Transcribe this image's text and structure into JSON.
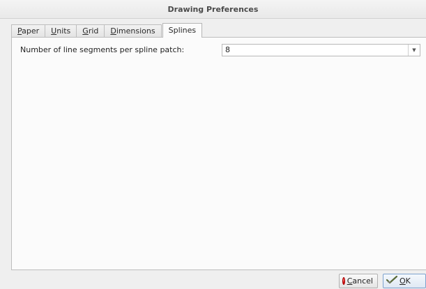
{
  "window": {
    "title": "Drawing Preferences"
  },
  "tabs": [
    {
      "mnemonic": "P",
      "rest": "aper"
    },
    {
      "mnemonic": "U",
      "rest": "nits"
    },
    {
      "mnemonic": "G",
      "rest": "rid"
    },
    {
      "mnemonic": "D",
      "rest": "imensions"
    },
    {
      "label": "Splines",
      "active": true
    }
  ],
  "splines": {
    "segments_label": "Number of line segments per spline patch:",
    "segments_value": "8"
  },
  "buttons": {
    "cancel": {
      "mnemonic": "C",
      "rest": "ancel",
      "icon": "cancel-red-dot-icon"
    },
    "ok": {
      "mnemonic": "O",
      "rest": "K",
      "icon": "ok-check-icon"
    }
  },
  "colors": {
    "accent": "#7da2ce",
    "cancel_icon": "#d40000"
  }
}
